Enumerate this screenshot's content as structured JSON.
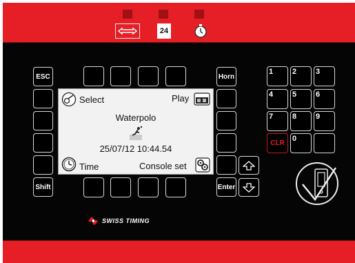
{
  "top": {
    "display_24": "24"
  },
  "keys": {
    "esc": "ESC",
    "shift": "Shift",
    "horn": "Horn",
    "enter": "Enter",
    "clr": "CLR",
    "numbers": [
      "1",
      "2",
      "3",
      "4",
      "5",
      "6",
      "7",
      "8",
      "9",
      "0"
    ]
  },
  "lcd": {
    "select": "Select",
    "play": "Play",
    "sport": "Waterpolo",
    "datetime": "25/07/12 10:44.54",
    "time": "Time",
    "console_set": "Console set"
  },
  "logo": {
    "text": "SWISS TIMING"
  }
}
